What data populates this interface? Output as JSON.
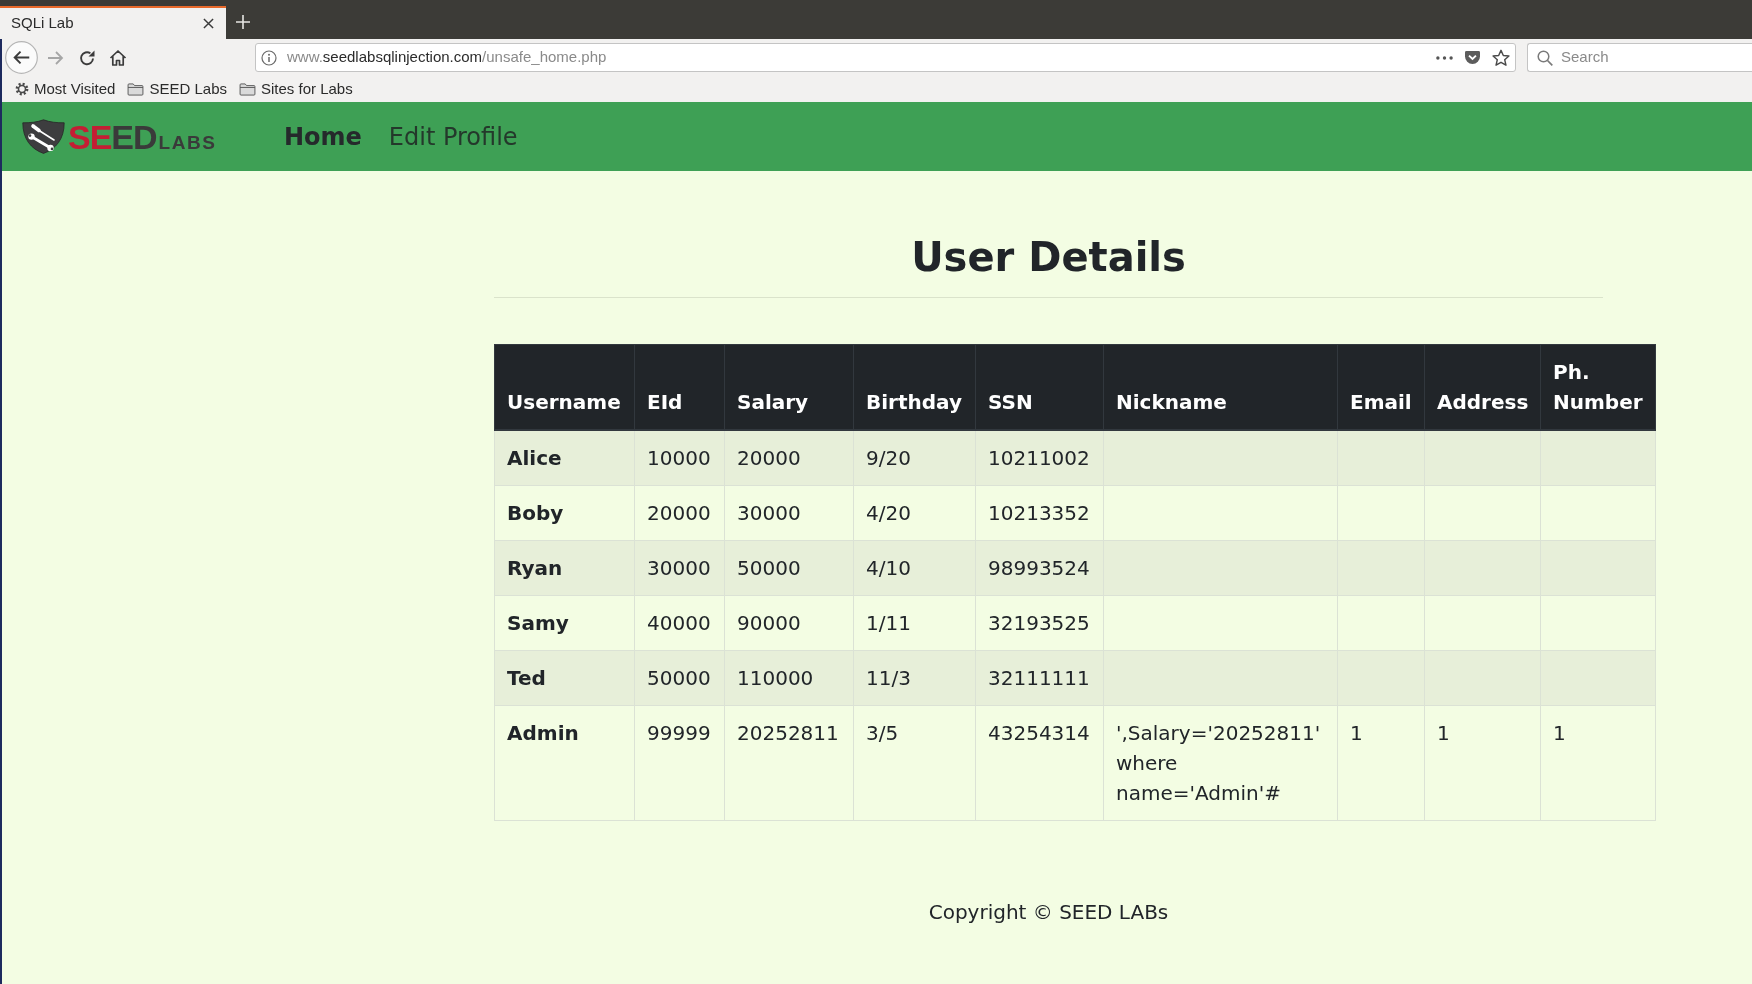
{
  "browser": {
    "tabs": [
      {
        "title": "SQLi Lab",
        "selected": true
      }
    ],
    "nav_buttons": [
      {
        "kind": "back",
        "disabled": false
      },
      {
        "kind": "forward",
        "disabled": true
      },
      {
        "kind": "reload",
        "disabled": false
      },
      {
        "kind": "home",
        "disabled": false
      }
    ],
    "address": {
      "host_prefix": "www.",
      "domain": "seedlabsqlinjection.com",
      "path": "/unsafe_home.php"
    },
    "search": {
      "placeholder": "Search"
    },
    "bookmarks": [
      {
        "kind": "smart",
        "label": "Most Visited"
      },
      {
        "kind": "folder",
        "label": "SEED Labs"
      },
      {
        "kind": "folder",
        "label": "Sites for Labs"
      }
    ]
  },
  "navbar": {
    "logo": [
      {
        "kind": "accent",
        "text": "SE"
      },
      {
        "kind": "plain",
        "text": "ED"
      },
      {
        "kind": "small",
        "text": "LABS"
      }
    ],
    "links": [
      {
        "label": "Home",
        "selected": true
      },
      {
        "label": "Edit Profile",
        "selected": false
      }
    ]
  },
  "page_title": "User Details",
  "table": {
    "columns": [
      "Username",
      "EId",
      "Salary",
      "Birthday",
      "SSN",
      "Nickname",
      "Email",
      "Address",
      "Ph. Number"
    ],
    "rows": [
      {
        "cells": [
          "Alice",
          "10000",
          "20000",
          "9/20",
          "10211002"
        ]
      },
      {
        "cells": [
          "Boby",
          "20000",
          "30000",
          "4/20",
          "10213352"
        ]
      },
      {
        "cells": [
          "Ryan",
          "30000",
          "50000",
          "4/10",
          "98993524"
        ]
      },
      {
        "cells": [
          "Samy",
          "40000",
          "90000",
          "1/11",
          "32193525"
        ]
      },
      {
        "cells": [
          "Ted",
          "50000",
          "110000",
          "11/3",
          "32111111"
        ]
      },
      {
        "cells": [
          "Admin",
          "99999",
          "20252811",
          "3/5",
          "43254314",
          "',Salary='20252811' where name='Admin'#",
          "1",
          "1",
          "1"
        ]
      }
    ]
  },
  "footer": "Copyright © SEED LABs"
}
